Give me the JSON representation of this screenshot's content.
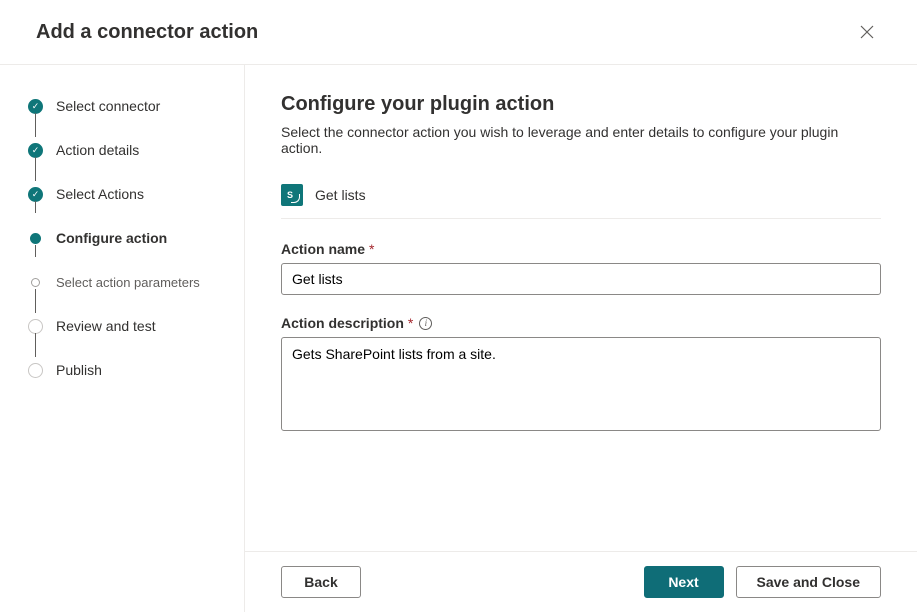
{
  "header": {
    "title": "Add a connector action"
  },
  "stepper": {
    "steps": [
      {
        "label": "Select connector",
        "state": "done"
      },
      {
        "label": "Action details",
        "state": "done"
      },
      {
        "label": "Select Actions",
        "state": "done"
      },
      {
        "label": "Configure action",
        "state": "active"
      },
      {
        "label": "Select action parameters",
        "state": "sub"
      },
      {
        "label": "Review and test",
        "state": "future"
      },
      {
        "label": "Publish",
        "state": "future"
      }
    ]
  },
  "main": {
    "title": "Configure your plugin action",
    "subtitle": "Select the connector action you wish to leverage and enter details to configure your plugin action.",
    "connector": {
      "icon_text": "S",
      "name": "Get lists"
    },
    "fields": {
      "action_name": {
        "label": "Action name",
        "value": "Get lists"
      },
      "action_description": {
        "label": "Action description",
        "value": "Gets SharePoint lists from a site."
      }
    }
  },
  "footer": {
    "back": "Back",
    "next": "Next",
    "save_close": "Save and Close"
  }
}
